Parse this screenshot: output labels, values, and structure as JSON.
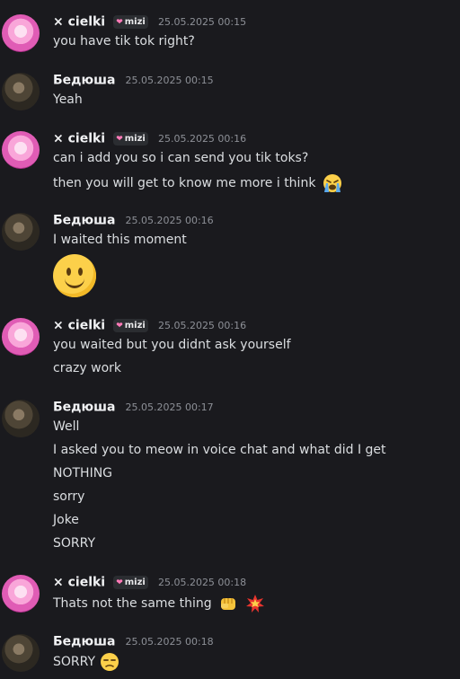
{
  "messages": [
    {
      "user": "× cielki",
      "tag": "mizi",
      "time": "25.05.2025 00:15",
      "lines": [
        "you have tik tok right?"
      ]
    },
    {
      "user": "Бедюша",
      "time": "25.05.2025 00:15",
      "lines": [
        "Yeah"
      ]
    },
    {
      "user": "× cielki",
      "tag": "mizi",
      "time": "25.05.2025 00:16",
      "lines": [
        "can i add you so i can send you tik toks?",
        "then you will get to know me more i think"
      ]
    },
    {
      "user": "Бедюша",
      "time": "25.05.2025 00:16",
      "lines": [
        "I waited this moment"
      ]
    },
    {
      "user": "× cielki",
      "tag": "mizi",
      "time": "25.05.2025 00:16",
      "lines": [
        "you waited but you didnt ask yourself",
        "crazy work"
      ]
    },
    {
      "user": "Бедюша",
      "time": "25.05.2025 00:17",
      "lines": [
        "Well",
        "I asked you to meow in voice chat and what did I get",
        "NOTHING",
        "sorry",
        "Joke",
        "SORRY"
      ]
    },
    {
      "user": "× cielki",
      "tag": "mizi",
      "time": "25.05.2025 00:18",
      "lines": [
        "Thats not the same thing"
      ]
    },
    {
      "user": "Бедюша",
      "time": "25.05.2025 00:18",
      "lines": [
        "SORRY"
      ]
    }
  ],
  "icons": {
    "crying": "loudly-crying-face-icon",
    "smile": "slightly-smiling-face-icon",
    "fist": "oncoming-fist-icon",
    "collision": "collision-icon",
    "unamused": "unamused-face-icon"
  },
  "colors": {
    "background": "#1a1a1e",
    "username": "#f2f3f5",
    "timestamp": "#8d9097",
    "text": "#dbdee1",
    "heart": "#ff7ab8"
  }
}
